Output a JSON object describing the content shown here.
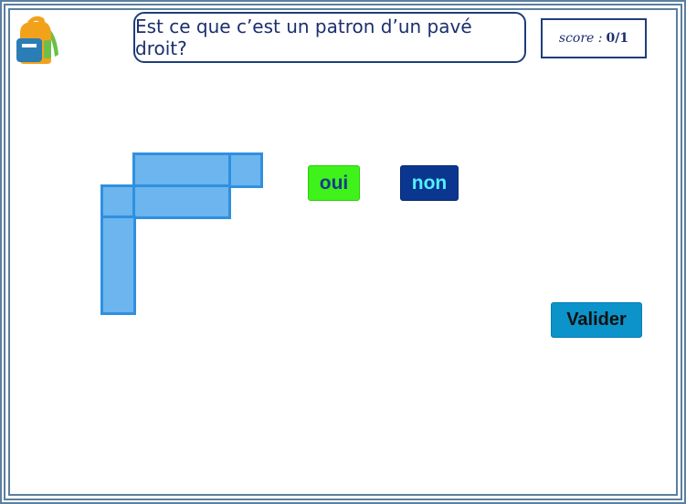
{
  "question": {
    "text": "Est ce que c’est un patron d’un pavé droit?"
  },
  "score": {
    "label": "score :",
    "value": "0/1"
  },
  "logo": {
    "icon": "backpack-icon"
  },
  "answers": {
    "yes_label": "oui",
    "no_label": "non"
  },
  "validate": {
    "label": "Valider"
  },
  "colors": {
    "face_fill": "#6db5ee",
    "face_stroke": "#2f90e0",
    "oui_bg": "#3ef21a",
    "non_bg": "#0b3690",
    "valider_bg": "#0c93c9",
    "frame": "#5b7fa0"
  }
}
